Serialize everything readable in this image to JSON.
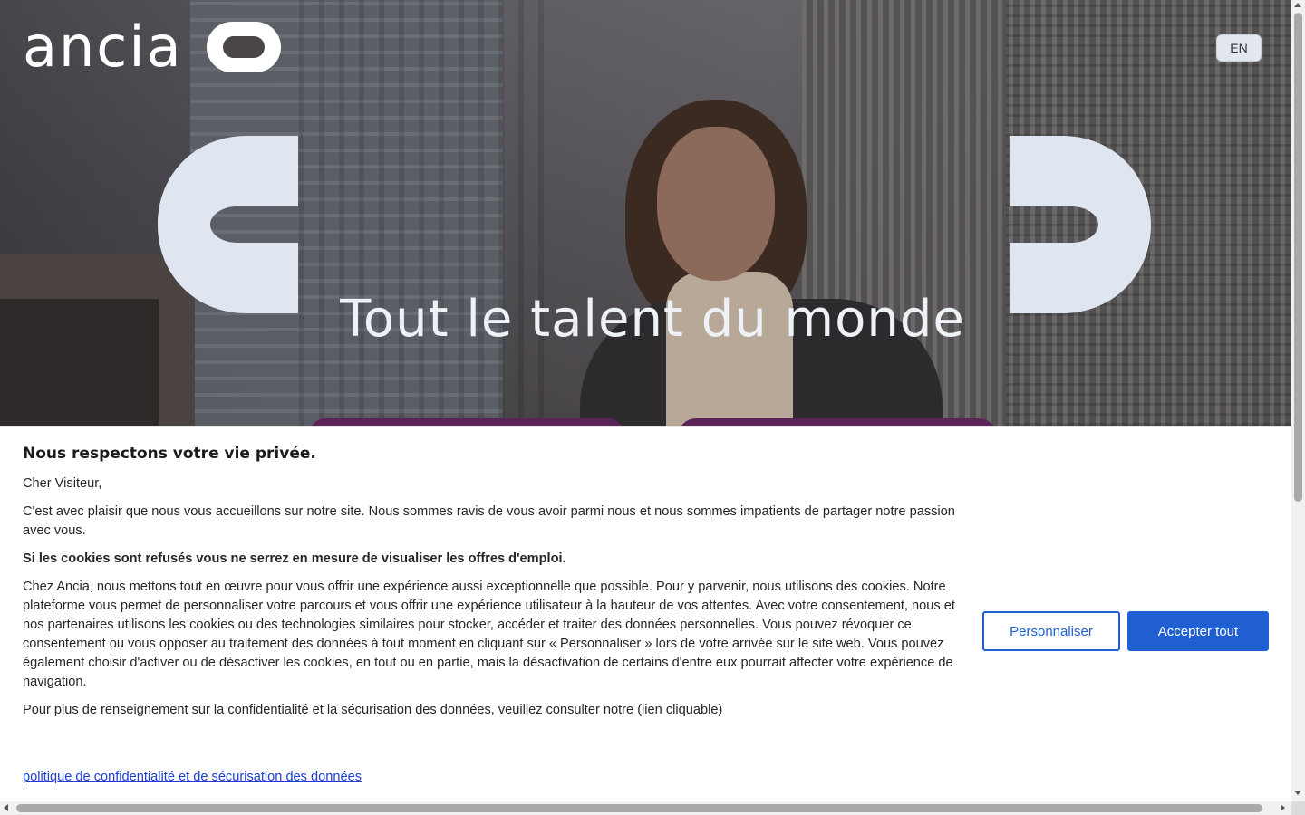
{
  "header": {
    "logo_text": "ancia",
    "lang_button": "EN"
  },
  "hero": {
    "title": "Tout le talent du monde"
  },
  "cookie_banner": {
    "heading": "Nous respectons votre vie privée.",
    "greeting": "Cher Visiteur,",
    "welcome": "C'est avec plaisir que nous vous accueillons sur notre site. Nous sommes ravis de vous avoir parmi nous et nous sommes impatients de partager notre passion avec vous.",
    "warning": "Si les cookies sont refusés vous ne serrez en mesure de visualiser les offres d'emploi.",
    "details": "Chez Ancia, nous mettons tout en œuvre pour vous offrir une expérience aussi exceptionnelle que possible. Pour y parvenir, nous utilisons des cookies. Notre plateforme vous permet de personnaliser votre parcours et vous offrir une expérience utilisateur à la hauteur de vos attentes. Avec votre consentement, nous et nos partenaires utilisons les cookies ou des technologies similaires pour stocker, accéder et traiter des données personnelles. Vous pouvez révoquer ce consentement ou vous opposer au traitement des données à tout moment en cliquant sur « Personnaliser » lors de votre arrivée sur le site web. Vous pouvez également choisir d'activer ou de désactiver les cookies, en tout ou en partie, mais la désactivation de certains d'entre eux pourrait affecter votre expérience de navigation.",
    "more_info": "Pour plus de renseignement sur la confidentialité et la sécurisation des données, veuillez consulter notre (lien cliquable)",
    "policy_link": "politique de confidentialité et de sécurisation des données",
    "personalize_button": "Personnaliser",
    "accept_button": "Accepter tout"
  },
  "colors": {
    "accent": "#1f5fd1",
    "bracket": "#dfe6f0",
    "purple_tab": "#5b2458"
  },
  "icons": {
    "logo_mark": "ancia-logo-mark",
    "hero_left": "left-bracket-shape",
    "hero_right": "right-bracket-shape"
  }
}
